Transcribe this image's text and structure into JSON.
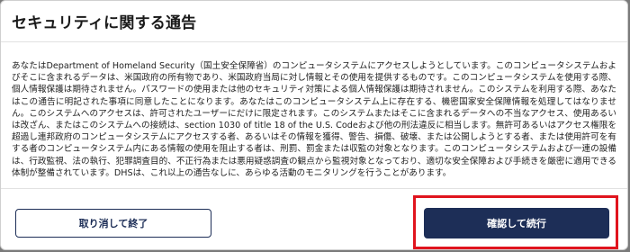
{
  "dialog": {
    "title": "セキュリティに関する通告",
    "body_text": "あなたはDepartment of Homeland Security（国土安全保障省）のコンピュータシステムにアクセスしようとしています。このコンピュータシステムおよびそこに含まれるデータは、米国政府の所有物であり、米国政府当局に対し情報とその使用を提供するものです。このコンピュータシステムを使用する際、個人情報保護は期待されません。パスワードの使用または他のセキュリティ対策による個人情報保護は期待されません。このシステムを利用する際、あなたはこの通告に明記された事項に同意したことになります。あなたはこのコンピュータシステム上に存在する、機密国家安全保障情報を処理してはなりません。このシステムへのアクセスは、許可されたユーザーにだけに限定されます。このシステムまたはそこに含まれるデータへの不当なアクセス、使用あるいは改ざん、またはこのシステムへの接続は、section 1030 of title 18 of the U.S. Codeおよび他の刑法違反に相当します。無許可あるいはアクセス権限を超過し連邦政府のコンピュータシステムにアクセスする者、あるいはその情報を獲得、警告、損傷、破壊、または公開しようとする者、または使用許可を有する者のコンピュータシステム内にある情報の使用を阻止する者は、刑罰、罰金または収監の対象となります。このコンピュータシステムおよび一連の設備は、行政監視、法の執行、犯罪調査目的、不正行為または悪用疑惑調査の観点から監視対象となっており、適切な安全保障および手続きを厳密に適用できる体制が整備されています。DHSは、これ以上の通告なしに、あらゆる活動のモニタリングを行うことがあります。",
    "cancel_label": "取り消して終了",
    "confirm_label": "確認して続行"
  },
  "colors": {
    "primary": "#1d2e57",
    "highlight": "#e0141e"
  }
}
